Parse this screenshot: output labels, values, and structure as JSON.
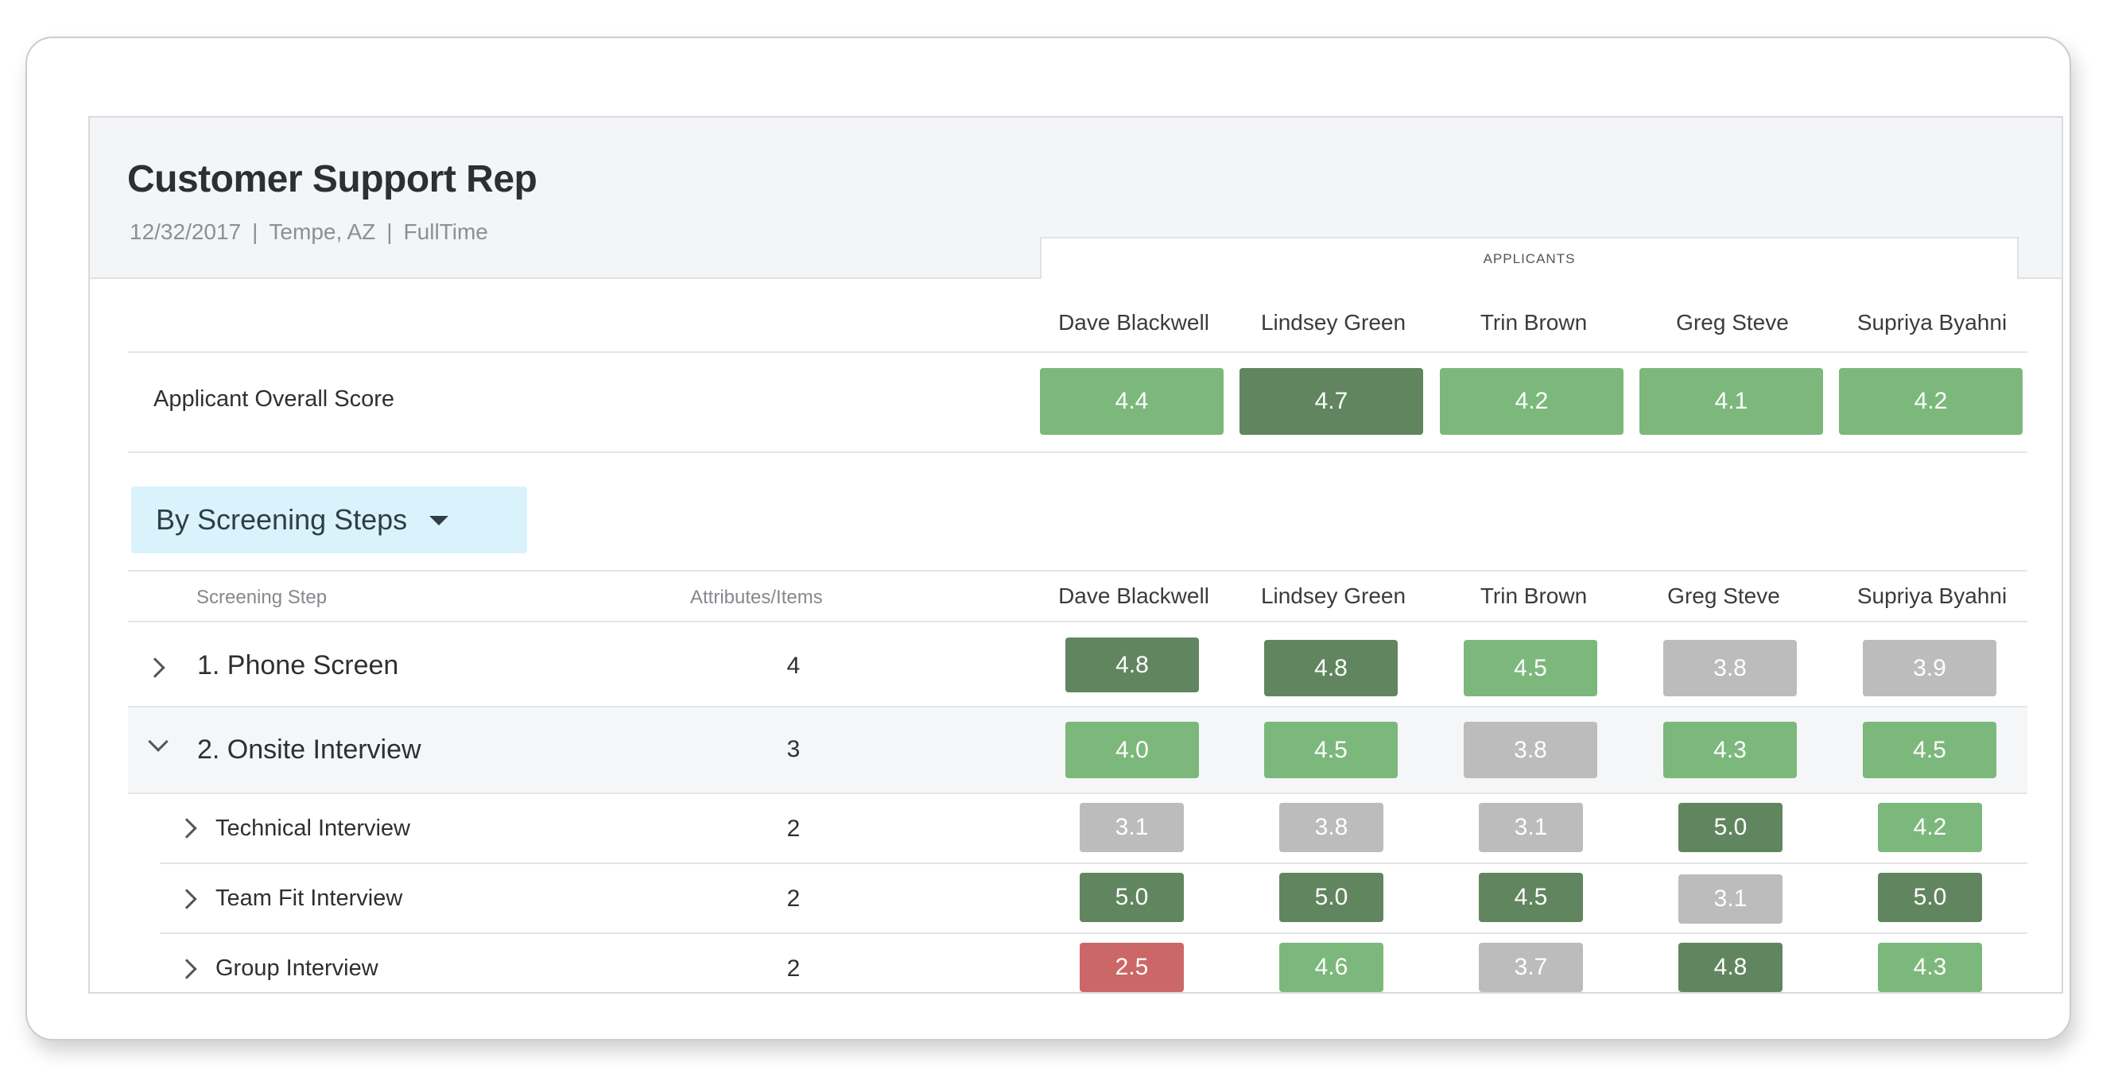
{
  "job": {
    "title": "Customer Support Rep",
    "date": "12/32/2017",
    "location": "Tempe, AZ",
    "type": "FullTime",
    "separator": "|"
  },
  "applicants_header": "APPLICANTS",
  "applicants": [
    "Dave Blackwell",
    "Lindsey Green",
    "Trin Brown",
    "Greg Steve",
    "Supriya Byahni"
  ],
  "overall": {
    "label": "Applicant Overall Score",
    "scores": [
      "4.4",
      "4.7",
      "4.2",
      "4.1",
      "4.2"
    ]
  },
  "dropdown": {
    "label": "By Screening Steps"
  },
  "table": {
    "col_step": "Screening Step",
    "col_items": "Attributes/Items",
    "rows": [
      {
        "label": "1. Phone Screen",
        "count": "4",
        "scores": [
          "4.8",
          "4.8",
          "4.5",
          "3.8",
          "3.9"
        ]
      },
      {
        "label": "2. Onsite Interview",
        "count": "3",
        "scores": [
          "4.0",
          "4.5",
          "3.8",
          "4.3",
          "4.5"
        ]
      }
    ],
    "subrows": [
      {
        "label": "Technical Interview",
        "count": "2",
        "scores": [
          "3.1",
          "3.8",
          "3.1",
          "5.0",
          "4.2"
        ]
      },
      {
        "label": "Team Fit Interview",
        "count": "2",
        "scores": [
          "5.0",
          "5.0",
          "4.5",
          "3.1",
          "5.0"
        ]
      },
      {
        "label": "Group Interview",
        "count": "2",
        "scores": [
          "2.5",
          "4.6",
          "3.7",
          "4.8",
          "4.3"
        ]
      }
    ]
  },
  "colors": {
    "light_green": "#7cb87c",
    "dark_green": "#61865f",
    "gray": "#bcbcbd",
    "red": "#cc6767",
    "dropdown_bg": "#daf2fc"
  }
}
